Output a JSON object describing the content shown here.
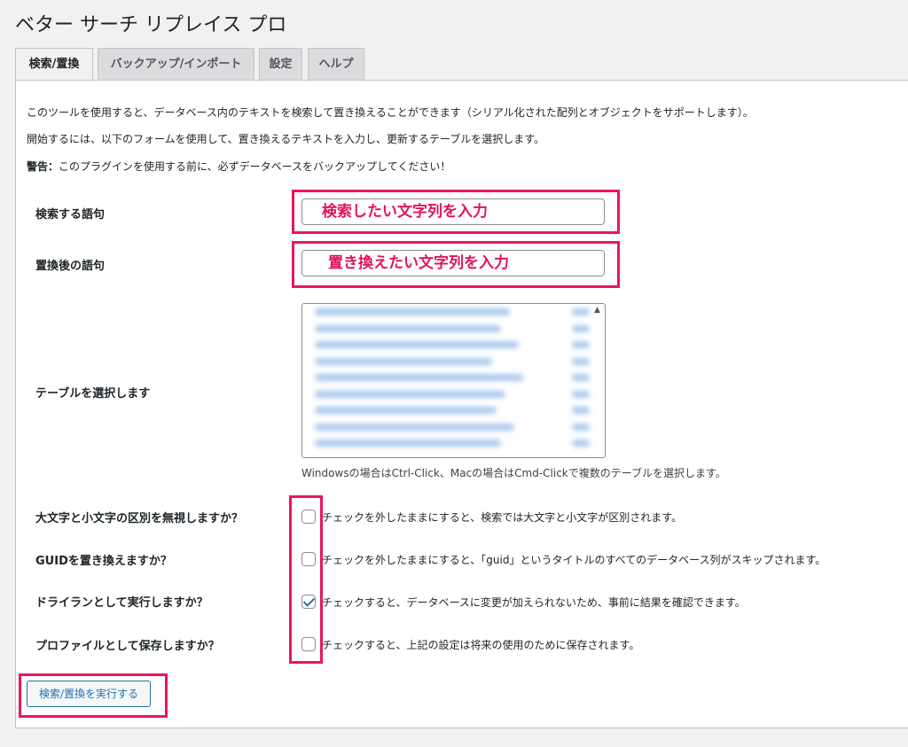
{
  "page": {
    "title": "ベター サーチ リプレイス プロ"
  },
  "tabs": [
    {
      "label": "検索/置換",
      "active": true
    },
    {
      "label": "バックアップ/インポート",
      "active": false
    },
    {
      "label": "設定",
      "active": false
    },
    {
      "label": "ヘルプ",
      "active": false
    }
  ],
  "intro": {
    "line1": "このツールを使用すると、データベース内のテキストを検索して置き換えることができます（シリアル化された配列とオブジェクトをサポートします）。",
    "line2": "開始するには、以下のフォームを使用して、置き換えるテキストを入力し、更新するテーブルを選択します。",
    "warning_label": "警告：",
    "warning_text": "このプラグインを使用する前に、必ずデータベースをバックアップしてください！"
  },
  "form": {
    "search_label": "検索する語句",
    "search_annotation": "検索したい文字列を入力",
    "replace_label": "置換後の語句",
    "replace_annotation": "置き換えたい文字列を入力",
    "tables_label": "テーブルを選択します",
    "tables_hint": "Windowsの場合はCtrl-Click、Macの場合はCmd-Clickで複数のテーブルを選択します。",
    "options": [
      {
        "label": "大文字と小文字の区別を無視しますか？",
        "desc": "チェックを外したままにすると、検索では大文字と小文字が区別されます。",
        "checked": false
      },
      {
        "label": "GUIDを置き換えますか？",
        "desc": "チェックを外したままにすると、「guid」というタイトルのすべてのデータベース列がスキップされます。",
        "checked": false
      },
      {
        "label": "ドライランとして実行しますか？",
        "desc": "チェックすると、データベースに変更が加えられないため、事前に結果を確認できます。",
        "checked": true
      },
      {
        "label": "プロファイルとして保存しますか？",
        "desc": "チェックすると、上記の設定は将来の使用のために保存されます。",
        "checked": false
      }
    ],
    "submit_label": "検索/置換を実行する"
  },
  "colors": {
    "highlight": "#e8175d",
    "annotation_text": "#e0155a",
    "accent": "#2271b1"
  }
}
